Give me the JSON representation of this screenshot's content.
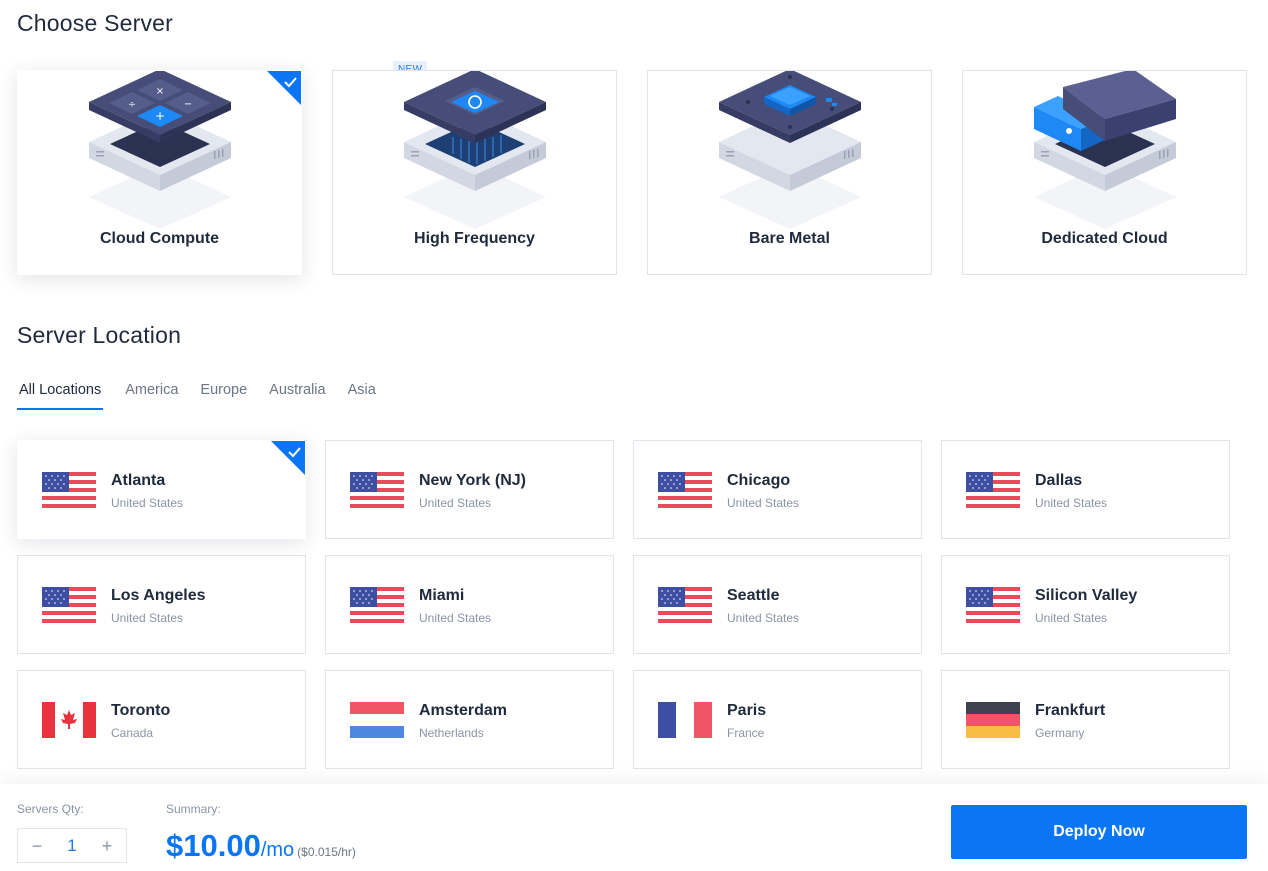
{
  "server_section": {
    "title": "Choose Server",
    "new_badge": "NEW",
    "cards": [
      {
        "label": "Cloud Compute",
        "selected": true
      },
      {
        "label": "High Frequency",
        "selected": false
      },
      {
        "label": "Bare Metal",
        "selected": false
      },
      {
        "label": "Dedicated Cloud",
        "selected": false
      }
    ]
  },
  "location_section": {
    "title": "Server Location",
    "tabs": [
      "All Locations",
      "America",
      "Europe",
      "Australia",
      "Asia"
    ],
    "active_tab": "All Locations",
    "locations": [
      {
        "city": "Atlanta",
        "country": "United States",
        "flag": "us-flag-icon",
        "selected": true
      },
      {
        "city": "New York (NJ)",
        "country": "United States",
        "flag": "us-flag-icon",
        "selected": false
      },
      {
        "city": "Chicago",
        "country": "United States",
        "flag": "us-flag-icon",
        "selected": false
      },
      {
        "city": "Dallas",
        "country": "United States",
        "flag": "us-flag-icon",
        "selected": false
      },
      {
        "city": "Los Angeles",
        "country": "United States",
        "flag": "us-flag-icon",
        "selected": false
      },
      {
        "city": "Miami",
        "country": "United States",
        "flag": "us-flag-icon",
        "selected": false
      },
      {
        "city": "Seattle",
        "country": "United States",
        "flag": "us-flag-icon",
        "selected": false
      },
      {
        "city": "Silicon Valley",
        "country": "United States",
        "flag": "us-flag-icon",
        "selected": false
      },
      {
        "city": "Toronto",
        "country": "Canada",
        "flag": "canada-flag-icon",
        "selected": false
      },
      {
        "city": "Amsterdam",
        "country": "Netherlands",
        "flag": "netherlands-flag-icon",
        "selected": false
      },
      {
        "city": "Paris",
        "country": "France",
        "flag": "france-flag-icon",
        "selected": false
      },
      {
        "city": "Frankfurt",
        "country": "Germany",
        "flag": "germany-flag-icon",
        "selected": false
      }
    ]
  },
  "bottom_bar": {
    "qty_label": "Servers Qty:",
    "qty_minus": "−",
    "qty_value": "1",
    "qty_plus": "+",
    "summary_label": "Summary:",
    "price_main": "$10.00",
    "price_unit": "/mo",
    "price_hourly": "($0.015/hr)",
    "deploy_label": "Deploy Now"
  },
  "colors": {
    "accent": "#0a75f5",
    "card_border": "#dfe3ea",
    "text_dark": "#1f2a3c",
    "text_muted": "#8a94a3"
  }
}
